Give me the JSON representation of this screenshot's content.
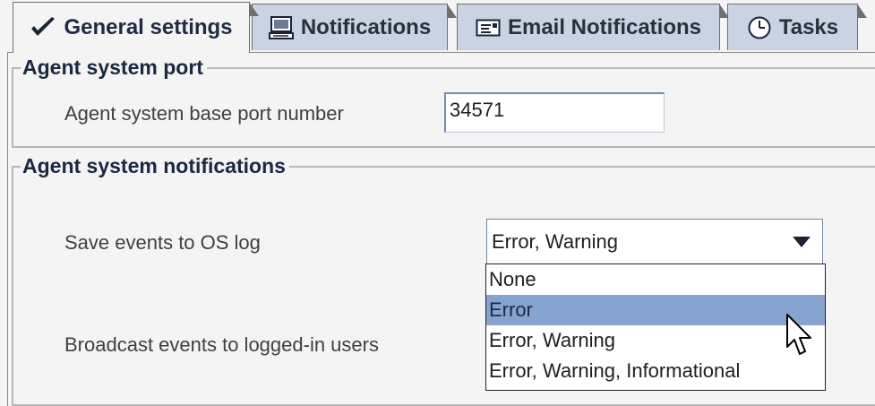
{
  "tabs": [
    {
      "label": "General settings",
      "icon": "checkmark-icon",
      "active": true
    },
    {
      "label": "Notifications",
      "icon": "computer-icon",
      "active": false
    },
    {
      "label": "Email Notifications",
      "icon": "envelope-icon",
      "active": false
    },
    {
      "label": "Tasks",
      "icon": "clock-icon",
      "active": false
    }
  ],
  "port_group": {
    "title": "Agent system port",
    "base_port_label": "Agent system base port number",
    "base_port_value": "34571"
  },
  "notifications_group": {
    "title": "Agent system notifications",
    "save_events_label": "Save events to OS log",
    "save_events_value": "Error, Warning",
    "broadcast_label": "Broadcast events to logged-in users",
    "options": [
      "None",
      "Error",
      "Error, Warning",
      "Error, Warning, Informational"
    ],
    "highlighted_option": "Error"
  },
  "colors": {
    "tab_bg": "#c9d3e3",
    "selection": "#87a4d1",
    "panel_bg": "#f4f4f4",
    "title_text": "#1a2840"
  }
}
